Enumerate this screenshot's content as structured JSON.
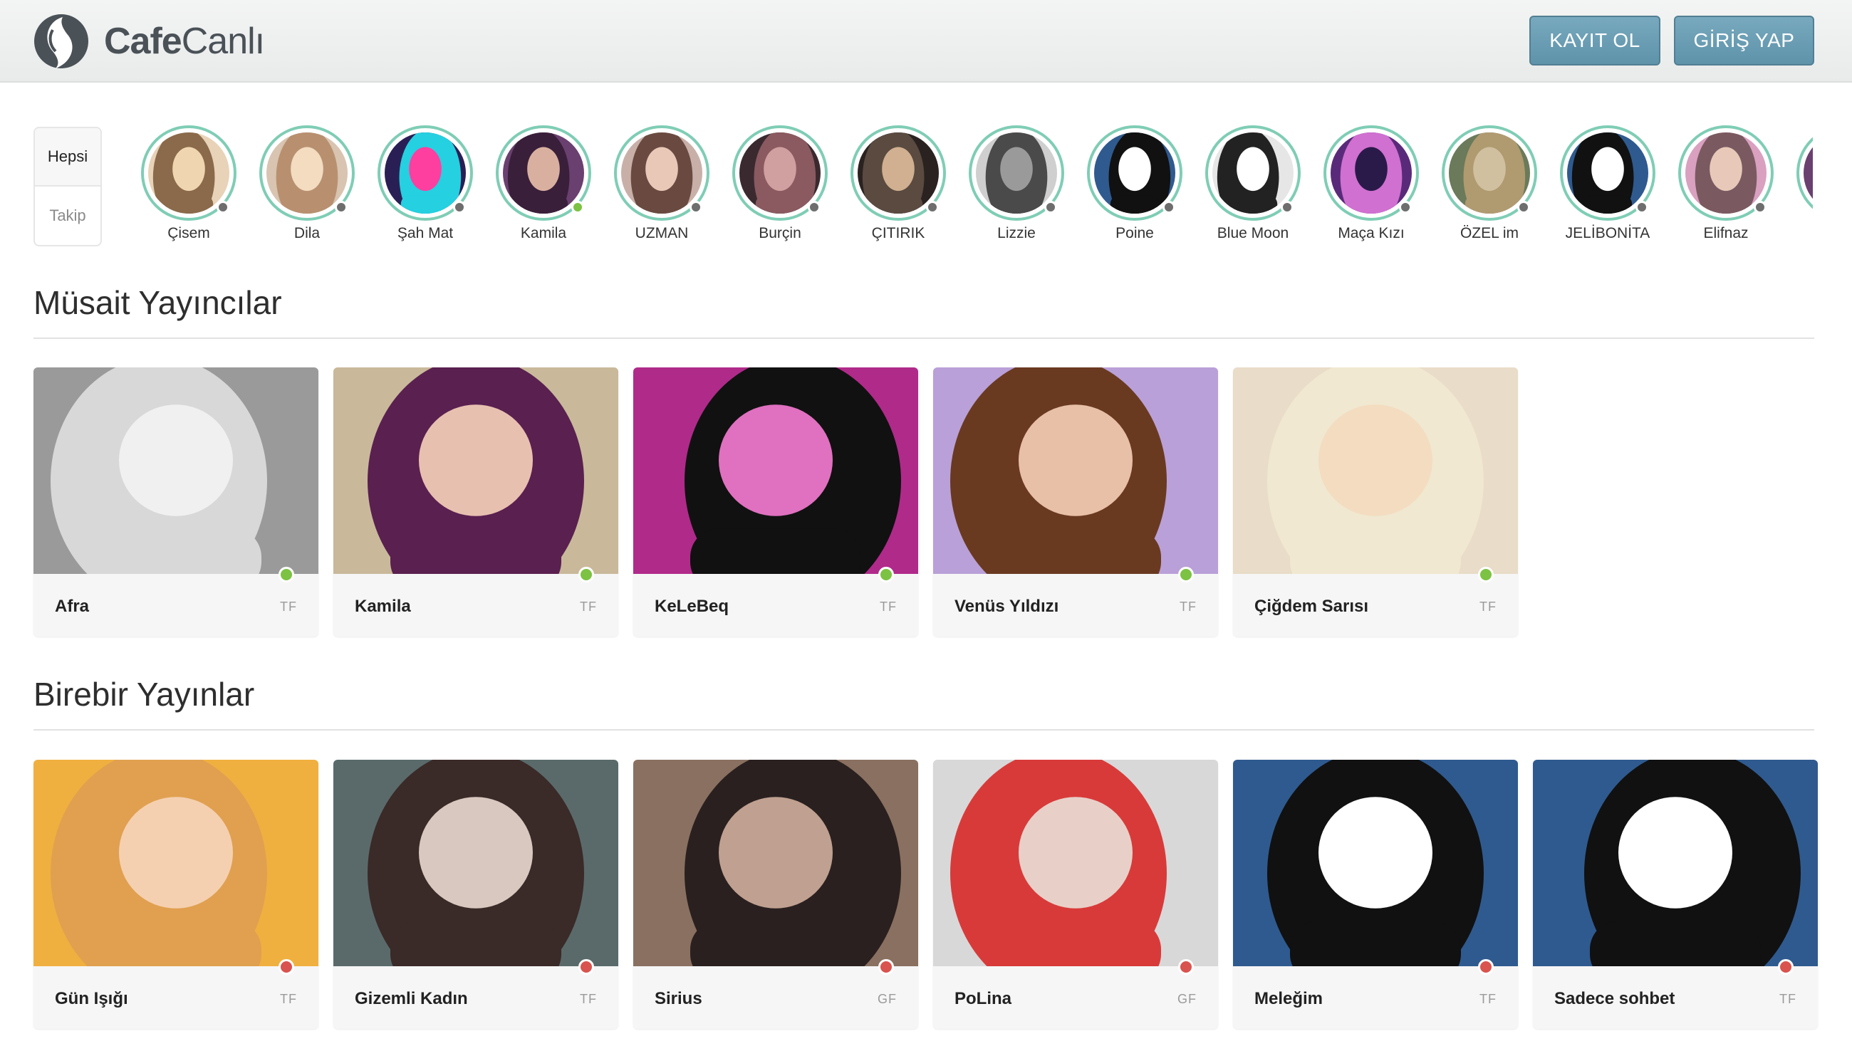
{
  "header": {
    "logo_text_bold": "Cafe",
    "logo_text_light": "Canlı",
    "register_label": "KAYIT OL",
    "login_label": "GİRİŞ YAP"
  },
  "filter": {
    "tabs": [
      "Hepsi",
      "Takip"
    ]
  },
  "stories": [
    {
      "name": "Çisem",
      "status": "offline"
    },
    {
      "name": "Dila",
      "status": "offline"
    },
    {
      "name": "Şah Mat",
      "status": "offline"
    },
    {
      "name": "Kamila",
      "status": "online"
    },
    {
      "name": "UZMAN",
      "status": "offline"
    },
    {
      "name": "Burçin",
      "status": "offline"
    },
    {
      "name": "ÇITIRIK",
      "status": "offline"
    },
    {
      "name": "Lizzie",
      "status": "offline"
    },
    {
      "name": "Poine",
      "status": "offline"
    },
    {
      "name": "Blue Moon",
      "status": "offline"
    },
    {
      "name": "Maça Kızı",
      "status": "offline"
    },
    {
      "name": "ÖZEL im",
      "status": "offline"
    },
    {
      "name": "JELİBONİTA",
      "status": "offline"
    },
    {
      "name": "Elifnaz",
      "status": "offline"
    }
  ],
  "available": {
    "title": "Müsait Yayıncılar",
    "cards": [
      {
        "name": "Afra",
        "tag": "TF",
        "status": "online"
      },
      {
        "name": "Kamila",
        "tag": "TF",
        "status": "online"
      },
      {
        "name": "KeLeBeq",
        "tag": "TF",
        "status": "online"
      },
      {
        "name": "Venüs Yıldızı",
        "tag": "TF",
        "status": "online"
      },
      {
        "name": "Çiğdem Sarısı",
        "tag": "TF",
        "status": "online"
      }
    ]
  },
  "private": {
    "title": "Birebir Yayınlar",
    "cards": [
      {
        "name": "Gün Işığı",
        "tag": "TF",
        "status": "busy"
      },
      {
        "name": "Gizemli Kadın",
        "tag": "TF",
        "status": "busy"
      },
      {
        "name": "Sirius",
        "tag": "GF",
        "status": "busy"
      },
      {
        "name": "PoLina",
        "tag": "GF",
        "status": "busy"
      },
      {
        "name": "Meleğim",
        "tag": "TF",
        "status": "busy"
      },
      {
        "name": "Sadece sohbet",
        "tag": "TF",
        "status": "busy"
      }
    ]
  },
  "colors": {
    "online": "#7cc243",
    "offline": "#6e6e6e",
    "busy": "#d9534f",
    "ring": "#7fcdb5",
    "button": "#6a9db3"
  }
}
